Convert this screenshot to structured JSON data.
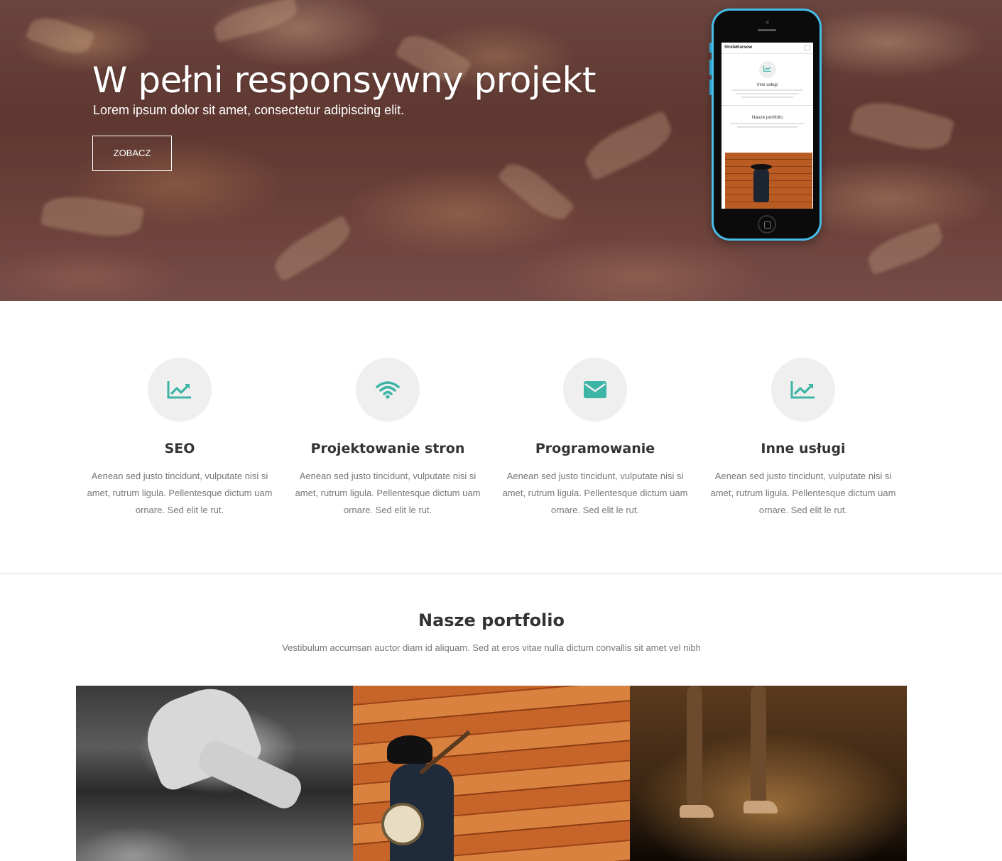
{
  "hero": {
    "title": "W pełni responsywny projekt",
    "subtitle": "Lorem ipsum dolor sit amet, consectetur adipiscing elit.",
    "button_label": "ZOBACZ"
  },
  "phone_screen": {
    "brand": "StrefaKursow",
    "section_title": "Inne usługi",
    "portfolio_title": "Nasze portfolio"
  },
  "services": [
    {
      "icon": "chart-line-icon",
      "title": "SEO",
      "text": "Aenean sed justo tincidunt, vulputate nisi si amet, rutrum ligula. Pellentesque dictum uam ornare. Sed elit le rut."
    },
    {
      "icon": "wifi-icon",
      "title": "Projektowanie stron",
      "text": "Aenean sed justo tincidunt, vulputate nisi si amet, rutrum ligula. Pellentesque dictum uam ornare. Sed elit le rut."
    },
    {
      "icon": "envelope-icon",
      "title": "Programowanie",
      "text": "Aenean sed justo tincidunt, vulputate nisi si amet, rutrum ligula. Pellentesque dictum uam ornare. Sed elit le rut."
    },
    {
      "icon": "chart-line-icon",
      "title": "Inne usługi",
      "text": "Aenean sed justo tincidunt, vulputate nisi si amet, rutrum ligula. Pellentesque dictum uam ornare. Sed elit le rut."
    }
  ],
  "portfolio": {
    "title": "Nasze portfolio",
    "subtitle": "Vestibulum accumsan auctor diam id aliquam. Sed at eros vitae nulla dictum convallis sit amet vel nibh",
    "items": [
      {
        "image": "car-garage-photo"
      },
      {
        "image": "banjo-player-photo"
      },
      {
        "image": "high-heels-photo"
      }
    ]
  },
  "colors": {
    "accent": "#3cb4a6",
    "icon_circle": "#efefef",
    "phone_body": "#45bde8"
  }
}
